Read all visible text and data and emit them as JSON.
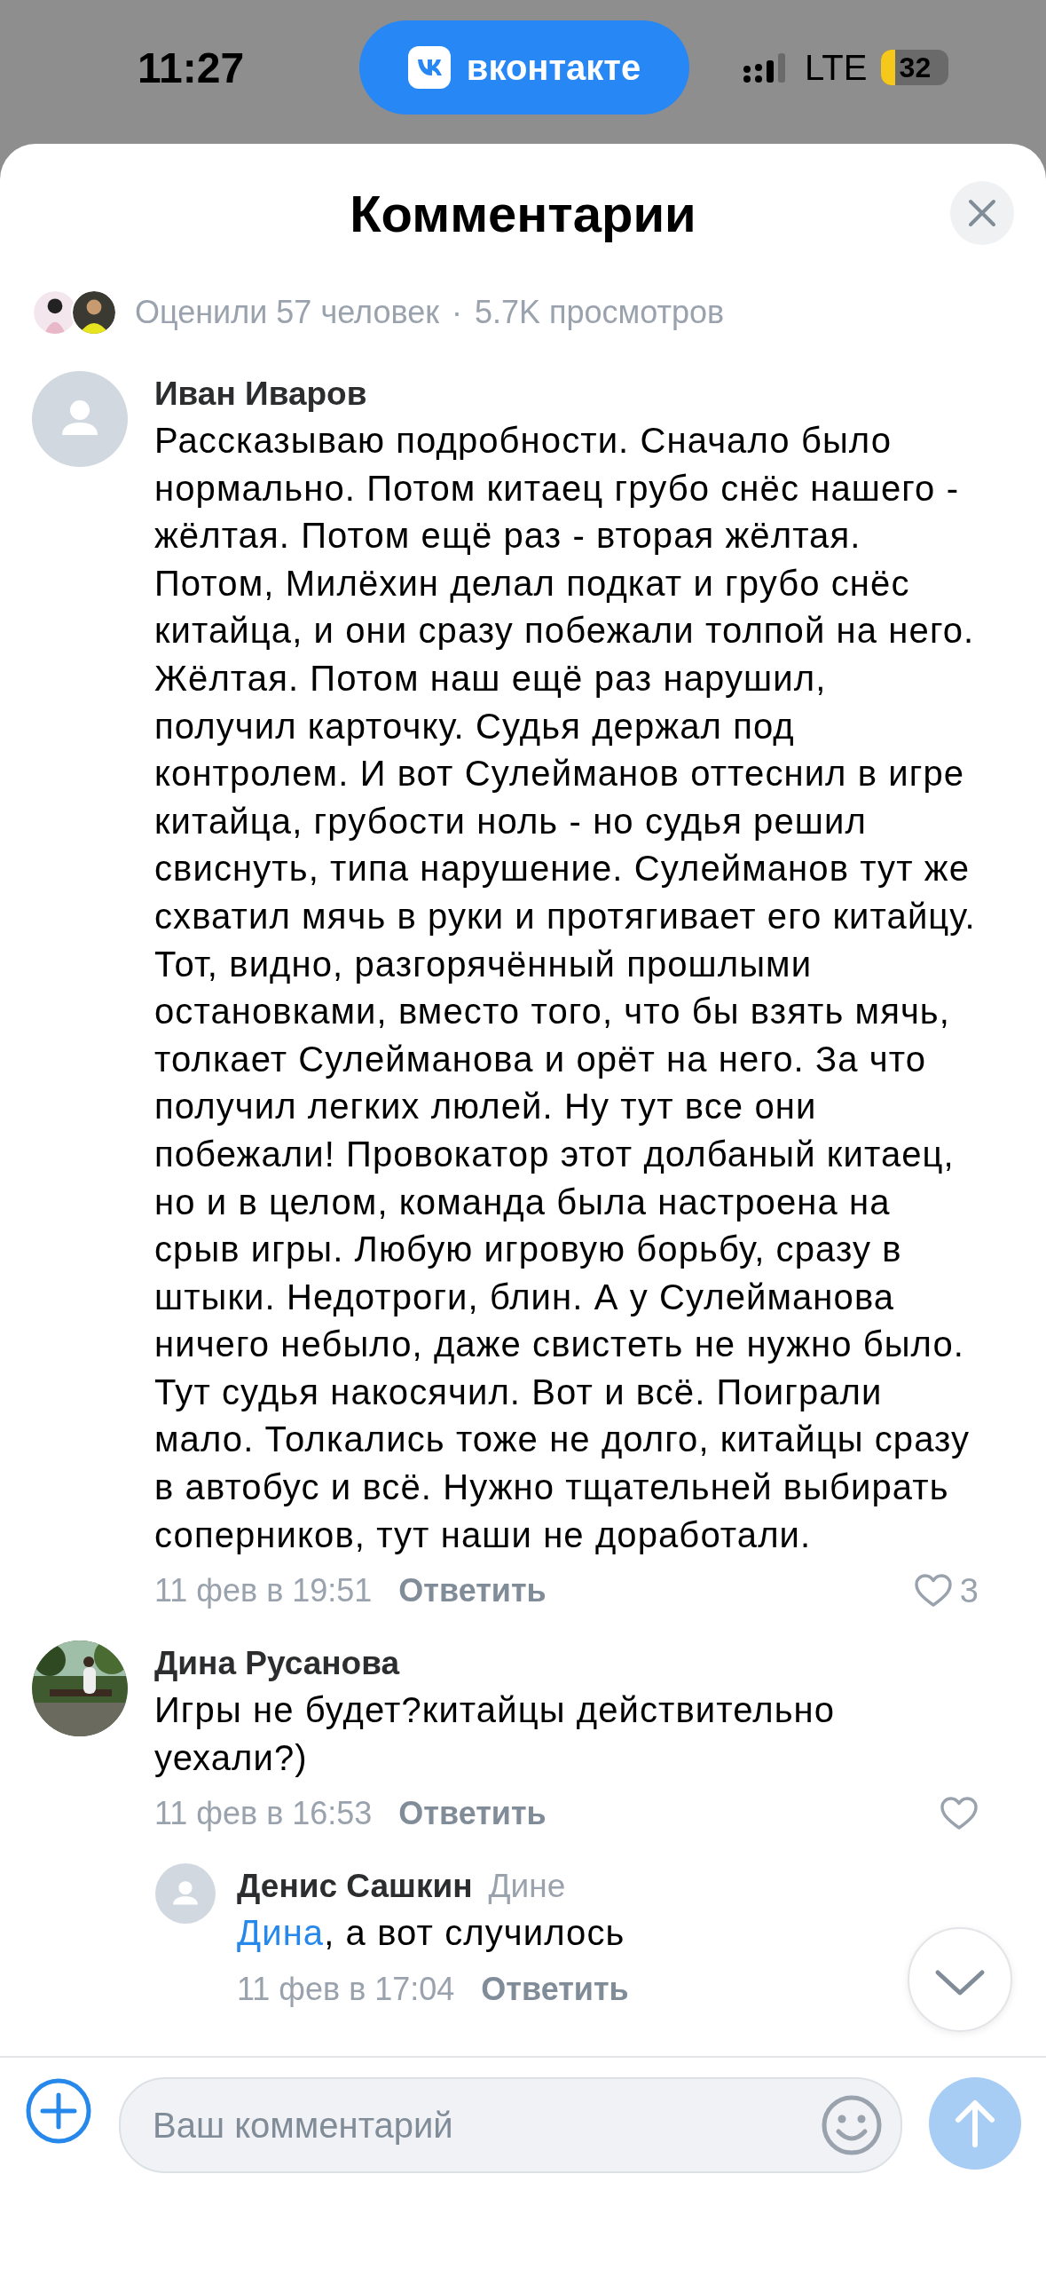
{
  "status_bar": {
    "time": "11:27",
    "app_pill": "вконтакте",
    "network": "LTE",
    "battery": "32"
  },
  "header": {
    "title": "Комментарии"
  },
  "stats": {
    "likes": "Оценили 57 человек",
    "separator": "·",
    "views": "5.7K просмотров"
  },
  "comments": [
    {
      "author": "Иван Иваров",
      "avatar": {
        "kind": "placeholder"
      },
      "text": "Рассказываю подробности. Сначало было нормально. Потом китаец грубо снёс нашего - жёлтая. Потом ещё раз - вторая жёлтая. Потом, Милёхин делал подкат и грубо снёс китайца, и они сразу побежали толпой на него. Жёлтая. Потом наш ещё раз нарушил, получил карточку. Судья держал под контролем. И вот Сулейманов оттеснил в игре китайца, грубости ноль - но судья решил свиснуть, типа нарушение. Сулейманов тут же схватил мячь в руки и протягивает его китайцу. Тот, видно, разгорячённый прошлыми остановками, вместо того, что бы взять мячь, толкает Сулейманова и орёт на него. За что получил легких люлей. Ну тут все они побежали! Провокатор этот долбаный китаец, но и в целом, команда была настроена на срыв игры. Любую игровую борьбу, сразу в штыки. Недотроги, блин. А у Сулейманова ничего небыло, даже свистеть не нужно было. Тут судья накосячил. Вот и всё. Поиграли мало. Толкались тоже не долго, китайцы сразу в автобус и всё. Нужно тщательней выбирать соперников, тут наши не доработали.",
      "date": "11 фев в 19:51",
      "reply": "Ответить",
      "like_button": true,
      "likes": "3"
    },
    {
      "author": "Дина Русанова",
      "avatar": {
        "kind": "picture"
      },
      "text": "Игры не будет?китайцы действительно уехали?)",
      "date": "11 фев в 16:53",
      "reply": "Ответить",
      "like_button": true,
      "replies": [
        {
          "author": "Денис Сашкин",
          "avatar": {
            "kind": "placeholder"
          },
          "reply_to": "Дине",
          "mention": "Дина",
          "text": ", а вот случилось",
          "date": "11 фев в 17:04",
          "reply": "Ответить",
          "like_button": false
        }
      ]
    }
  ],
  "composer": {
    "placeholder": "Ваш комментарий",
    "send_disabled": true
  }
}
